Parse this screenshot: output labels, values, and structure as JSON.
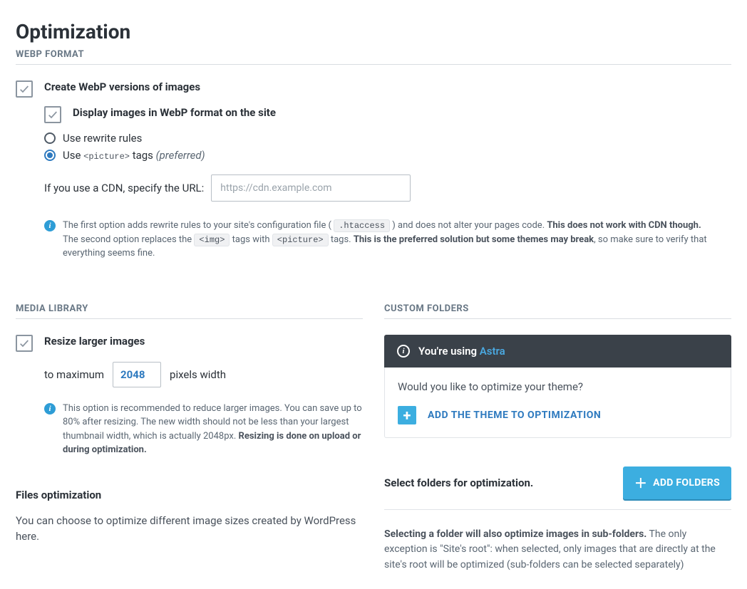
{
  "page": {
    "title": "Optimization"
  },
  "webp": {
    "section_label": "WEBP FORMAT",
    "create_label": "Create WebP versions of images",
    "display_label": "Display images in WebP format on the site",
    "radio_rewrite": "Use rewrite rules",
    "radio_picture_prefix": "Use ",
    "radio_picture_code": "<picture>",
    "radio_picture_suffix": " tags ",
    "radio_picture_preferred": "(preferred)",
    "cdn_label": "If you use a CDN, specify the URL:",
    "cdn_placeholder": "https://cdn.example.com",
    "info": {
      "l1a": "The first option adds rewrite rules to your site's configuration file ( ",
      "l1_code": ".htaccess",
      "l1b": " ) and does not alter your pages code. ",
      "l1_bold": "This does not work with CDN though.",
      "l2a": "The second option replaces the ",
      "l2_code1": "<img>",
      "l2b": " tags with ",
      "l2_code2": "<picture>",
      "l2c": " tags. ",
      "l2_bold": "This is the preferred solution but some themes may break",
      "l2d": ", so make sure to verify that everything seems fine."
    }
  },
  "media": {
    "section_label": "MEDIA LIBRARY",
    "resize_label": "Resize larger images",
    "to_max": "to maximum",
    "value": "2048",
    "px_width": "pixels width",
    "info_a": "This option is recommended to reduce larger images. You can save up to 80% after resizing. The new width should not be less than your largest thumbnail width, which is actually 2048px. ",
    "info_bold": "Resizing is done on upload or during optimization."
  },
  "files": {
    "title": "Files optimization",
    "desc": "You can choose to optimize different image sizes created by WordPress here."
  },
  "custom": {
    "section_label": "CUSTOM FOLDERS",
    "using_prefix": "You're using ",
    "theme_name": "Astra",
    "question": "Would you like to optimize your theme?",
    "add_theme": "ADD THE THEME TO OPTIMIZATION",
    "select_folders": "Select folders for optimization.",
    "add_folders": "ADD FOLDERS",
    "desc_bold": "Selecting a folder will also optimize images in sub-folders.",
    "desc_rest": " The only exception is \"Site's root\": when selected, only images that are directly at the site's root will be optimized (sub-folders can be selected separately)"
  }
}
